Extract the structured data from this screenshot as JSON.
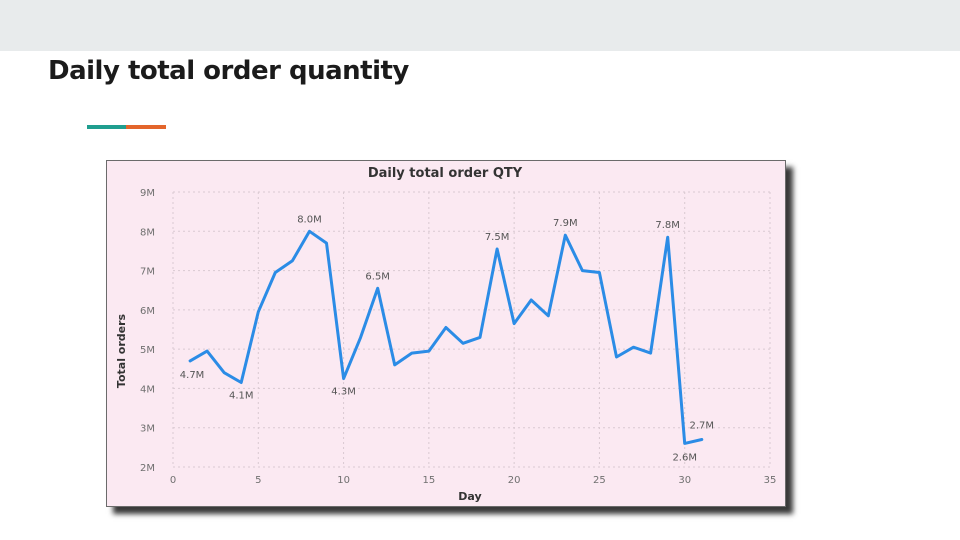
{
  "page": {
    "title": "Daily total order quantity",
    "accent_colors": [
      "#1f9e8f",
      "#e3652b"
    ]
  },
  "chart_data": {
    "type": "line",
    "title": "Daily total order QTY",
    "xlabel": "Day",
    "ylabel": "Total orders",
    "xlim": [
      0,
      35
    ],
    "ylim": [
      2000000,
      9000000
    ],
    "x_ticks": [
      0,
      5,
      10,
      15,
      20,
      25,
      30,
      35
    ],
    "x_tick_labels": [
      "0",
      "5",
      "10",
      "15",
      "20",
      "25",
      "30",
      "35"
    ],
    "y_ticks": [
      2000000,
      3000000,
      4000000,
      5000000,
      6000000,
      7000000,
      8000000,
      9000000
    ],
    "y_tick_labels": [
      "2M",
      "3M",
      "4M",
      "5M",
      "6M",
      "7M",
      "8M",
      "9M"
    ],
    "grid": true,
    "line_color": "#2b8ce6",
    "background_color": "#fbe9f2",
    "series": [
      {
        "x": [
          1,
          2,
          3,
          4,
          5,
          6,
          7,
          8,
          9,
          10,
          11,
          12,
          13,
          14,
          15,
          16,
          17,
          18,
          19,
          20,
          21,
          22,
          23,
          24,
          25,
          26,
          27,
          28,
          29,
          30,
          31
        ],
        "values": [
          4700000,
          4950000,
          4400000,
          4150000,
          5950000,
          6950000,
          7250000,
          8000000,
          7700000,
          4250000,
          5300000,
          6550000,
          4600000,
          4900000,
          4950000,
          5550000,
          5150000,
          5300000,
          7550000,
          5650000,
          6250000,
          5850000,
          7900000,
          7000000,
          6950000,
          4800000,
          5050000,
          4900000,
          7850000,
          2600000,
          2700000
        ]
      }
    ],
    "data_labels": [
      {
        "x": 1,
        "text": "4.7M",
        "dx": 2,
        "dy": 17
      },
      {
        "x": 4,
        "text": "4.1M",
        "dx": 0,
        "dy": 16
      },
      {
        "x": 8,
        "text": "8.0M",
        "dx": 0,
        "dy": -9
      },
      {
        "x": 10,
        "text": "4.3M",
        "dx": 0,
        "dy": 16
      },
      {
        "x": 12,
        "text": "6.5M",
        "dx": 0,
        "dy": -9
      },
      {
        "x": 19,
        "text": "7.5M",
        "dx": 0,
        "dy": -9
      },
      {
        "x": 23,
        "text": "7.9M",
        "dx": 0,
        "dy": -9
      },
      {
        "x": 29,
        "text": "7.8M",
        "dx": 0,
        "dy": -9
      },
      {
        "x": 30,
        "text": "2.6M",
        "dx": 0,
        "dy": 17
      },
      {
        "x": 31,
        "text": "2.7M",
        "dx": 0,
        "dy": -11
      }
    ]
  }
}
